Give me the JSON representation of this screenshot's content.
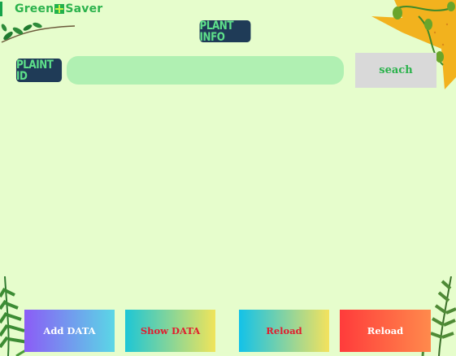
{
  "brand": {
    "part1": "Green",
    "part2": "Saver",
    "icon": "plus-square-icon"
  },
  "header": {
    "title": "PLANT INFO"
  },
  "search": {
    "id_label": "PLAINT ID",
    "input_value": "",
    "button_label": "seach"
  },
  "actions": {
    "add": "Add DATA",
    "show": "Show DATA",
    "reload1": "Reload",
    "reload2": "Reload"
  },
  "colors": {
    "background": "#e6fdcc",
    "tag_bg": "#1f3b57",
    "tag_text": "#5ee08a",
    "input_bg": "#b0f0b2",
    "brand_green": "#2bb24c"
  }
}
